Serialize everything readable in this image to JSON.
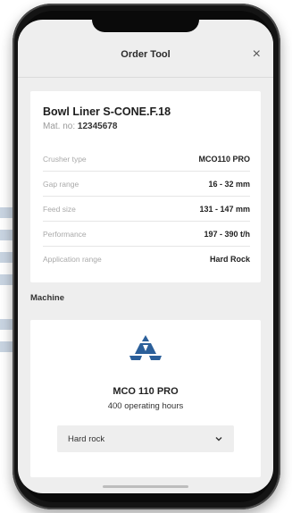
{
  "header": {
    "title": "Order Tool",
    "close_icon": "close-icon"
  },
  "product": {
    "name": "Bowl Liner S-CONE.F.18",
    "mat_no_label": "Mat. no:",
    "mat_no_value": "12345678",
    "specs": [
      {
        "label": "Crusher type",
        "value": "MCO110 PRO"
      },
      {
        "label": "Gap range",
        "value": "16 - 32 mm"
      },
      {
        "label": "Feed size",
        "value": "131 - 147 mm"
      },
      {
        "label": "Performance",
        "value": "197 - 390 t/h"
      },
      {
        "label": "Application range",
        "value": "Hard Rock"
      }
    ]
  },
  "machine": {
    "section_title": "Machine",
    "icon": "cone-crusher-icon",
    "name": "MCO 110 PRO",
    "hours": "400 operating hours",
    "select": {
      "value": "Hard rock",
      "icon": "chevron-down-icon"
    }
  },
  "colors": {
    "accent": "#2b5f9a",
    "card": "#ffffff",
    "screen_bg": "#eeeeee"
  }
}
